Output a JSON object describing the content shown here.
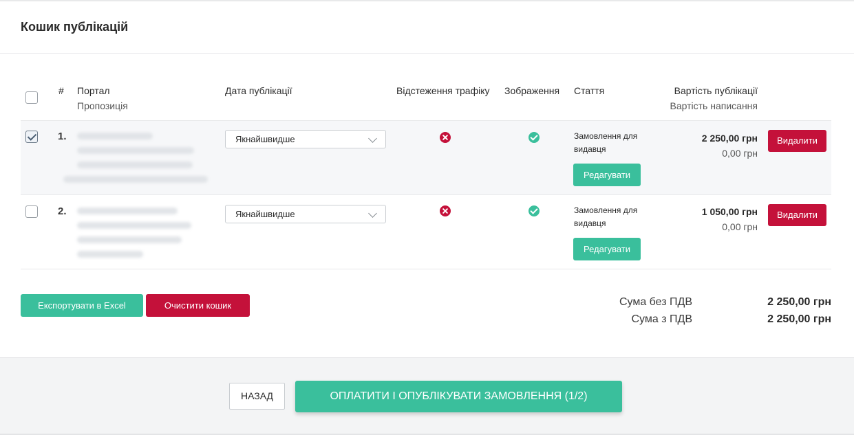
{
  "page": {
    "title": "Кошик публікацій"
  },
  "table": {
    "headers": {
      "num": "#",
      "portal": "Портал",
      "proposal": "Пропозиція",
      "date": "Дата публікації",
      "traffic": "Відстеження трафіку",
      "images": "Зображення",
      "article": "Стаття",
      "cost_pub": "Вартість публікації",
      "cost_write": "Вартість написання"
    },
    "rows": [
      {
        "selected": true,
        "index": "1.",
        "date_value": "Якнайшвидше",
        "traffic": "no",
        "images": "yes",
        "article_text": "Замовлення для видавця",
        "edit_label": "Редагувати",
        "price_pub": "2 250,00 грн",
        "price_write": "0,00 грн",
        "delete_label": "Видалити"
      },
      {
        "selected": false,
        "index": "2.",
        "date_value": "Якнайшвидше",
        "traffic": "no",
        "images": "yes",
        "article_text": "Замовлення для видавця",
        "edit_label": "Редагувати",
        "price_pub": "1 050,00 грн",
        "price_write": "0,00 грн",
        "delete_label": "Видалити"
      }
    ]
  },
  "actions": {
    "export_label": "Експортувати в Excel",
    "clear_label": "Очистити кошик"
  },
  "summary": {
    "no_vat_label": "Сума без ПДВ",
    "no_vat_value": "2 250,00 грн",
    "with_vat_label": "Сума з ПДВ",
    "with_vat_value": "2 250,00 грн"
  },
  "footer": {
    "back_label": "НАЗАД",
    "pay_label": "ОПЛАТИТИ І ОПУБЛІКУВАТИ ЗАМОВЛЕННЯ (1/2)"
  },
  "colors": {
    "accent": "#3abf9c",
    "danger": "#c4113a"
  }
}
